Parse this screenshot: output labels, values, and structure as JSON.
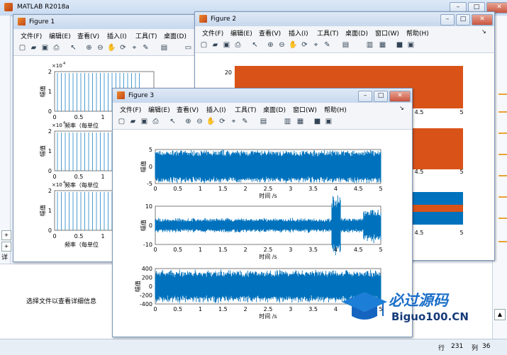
{
  "main": {
    "title": "MATLAB R2018a",
    "detail_text": "选择文件以查看详细信息",
    "status": {
      "line_label": "行",
      "line_value": "231",
      "col_label": "列",
      "col_value": "36"
    }
  },
  "win_buttons": {
    "min": "–",
    "max": "□",
    "close": "✕"
  },
  "figure1": {
    "title": "Figure 1",
    "menu": [
      "文件(F)",
      "编辑(E)",
      "查看(V)",
      "插入(I)",
      "工具(T)",
      "桌面(D)"
    ],
    "exp_label": "×10",
    "exp_power": "4",
    "ylabel": "幅值",
    "xlabel": "频率（每单位",
    "y_ticks": [
      "2",
      "1",
      "0"
    ],
    "x_ticks": [
      "0",
      "0.5",
      "1",
      "1"
    ]
  },
  "figure2": {
    "title": "Figure 2",
    "menu": [
      "文件(F)",
      "编辑(E)",
      "查看(V)",
      "插入(I)",
      "工具(T)",
      "桌面(D)",
      "窗口(W)",
      "帮助(H)"
    ],
    "y_tick_top": "20",
    "x_ticks": [
      "4",
      "4.5",
      "5"
    ]
  },
  "figure3": {
    "title": "Figure 3",
    "menu": [
      "文件(F)",
      "编辑(E)",
      "查看(V)",
      "插入(I)",
      "工具(T)",
      "桌面(D)",
      "窗口(W)",
      "帮助(H)"
    ],
    "ylabel": "幅值",
    "xlabel": "时间 /s",
    "x_ticks": [
      "0",
      "0.5",
      "1",
      "1.5",
      "2",
      "2.5",
      "3",
      "3.5",
      "4",
      "4.5",
      "5"
    ],
    "plots": [
      {
        "y_ticks": [
          "5",
          "0",
          "-5"
        ]
      },
      {
        "y_ticks": [
          "10",
          "0",
          "-10"
        ]
      },
      {
        "y_ticks": [
          "400",
          "200",
          "0",
          "-200",
          "-400"
        ]
      }
    ]
  },
  "colors": {
    "signal_blue": "#0072bd",
    "orange": "#d95319"
  },
  "watermark": {
    "text_cn": "必过源码",
    "text_en": "Biguo100.CN"
  }
}
